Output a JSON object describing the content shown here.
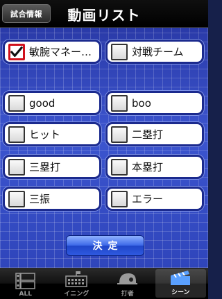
{
  "navbar": {
    "back_label": "試合情報",
    "title": "動画リスト"
  },
  "items": [
    {
      "label": "敏腕マネー…",
      "checked": true
    },
    {
      "label": "対戦チーム",
      "checked": false
    },
    {
      "label": "good",
      "checked": false
    },
    {
      "label": "boo",
      "checked": false
    },
    {
      "label": "ヒット",
      "checked": false
    },
    {
      "label": "二塁打",
      "checked": false
    },
    {
      "label": "三塁打",
      "checked": false
    },
    {
      "label": "本塁打",
      "checked": false
    },
    {
      "label": "三振",
      "checked": false
    },
    {
      "label": "エラー",
      "checked": false
    }
  ],
  "decide_label": "決定",
  "tabs": [
    {
      "label": "ALL",
      "icon": "film-grid-icon",
      "active": false
    },
    {
      "label": "イニング",
      "icon": "scoreboard-icon",
      "active": false
    },
    {
      "label": "打者",
      "icon": "helmet-icon",
      "active": false
    },
    {
      "label": "シーン",
      "icon": "clapperboard-icon",
      "active": true
    }
  ],
  "colors": {
    "check_active": "#d0111c",
    "accent": "#2f5ae0"
  }
}
